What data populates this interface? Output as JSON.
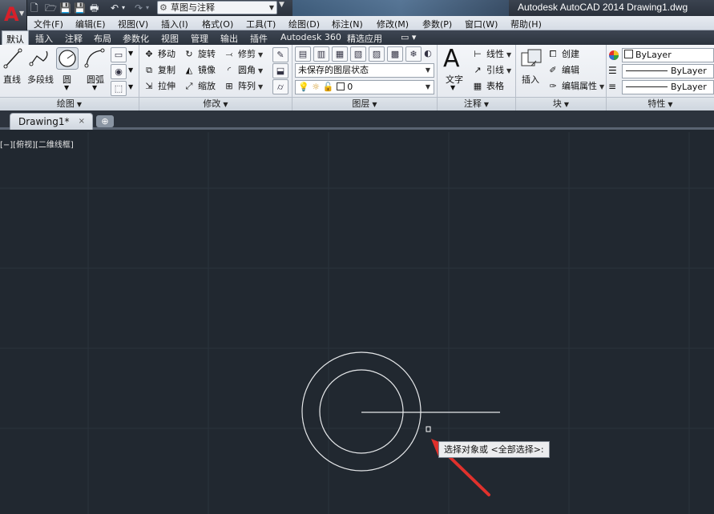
{
  "window": {
    "title": "Autodesk AutoCAD 2014    Drawing1.dwg",
    "app_logo": "A",
    "workspace": "草图与注释"
  },
  "quick_access": {
    "icons": [
      "new-icon",
      "open-icon",
      "save-icon",
      "save-as-icon",
      "plot-icon",
      "undo-icon",
      "redo-icon"
    ]
  },
  "menubar": {
    "items": [
      "文件(F)",
      "编辑(E)",
      "视图(V)",
      "插入(I)",
      "格式(O)",
      "工具(T)",
      "绘图(D)",
      "标注(N)",
      "修改(M)",
      "参数(P)",
      "窗口(W)",
      "帮助(H)"
    ]
  },
  "ribbon_tabs": {
    "items": [
      "默认",
      "插入",
      "注释",
      "布局",
      "参数化",
      "视图",
      "管理",
      "输出",
      "插件",
      "Autodesk 360",
      "精选应用"
    ],
    "active": "默认"
  },
  "ribbon": {
    "draw": {
      "title": "绘图",
      "line": "直线",
      "polyline": "多段线",
      "circle": "圆",
      "arc": "圆弧"
    },
    "modify": {
      "title": "修改",
      "move": "移动",
      "rotate": "旋转",
      "trim": "修剪",
      "copy": "复制",
      "mirror": "镜像",
      "fillet": "圆角",
      "stretch": "拉伸",
      "scale": "缩放",
      "array": "阵列"
    },
    "layers": {
      "title": "图层",
      "state": "未保存的图层状态",
      "current_layer": "0"
    },
    "annotation": {
      "title": "注释",
      "text": "文字",
      "linear": "线性",
      "leader": "引线",
      "table": "表格"
    },
    "block": {
      "title": "块",
      "insert": "插入",
      "create": "创建",
      "edit": "编辑",
      "edit_attributes": "编辑属性"
    },
    "properties": {
      "title": "特性",
      "color": "ByLayer",
      "linetype": "ByLayer",
      "lineweight": "ByLayer"
    }
  },
  "document_tab": {
    "name": "Drawing1*",
    "close": "×"
  },
  "canvas": {
    "viewport_label": "[−][俯视][二维线框]",
    "command_prompt": "选择对象或 <全部选择>:",
    "background_color": "#212830",
    "annotation_arrow_color": "#e0312c"
  }
}
